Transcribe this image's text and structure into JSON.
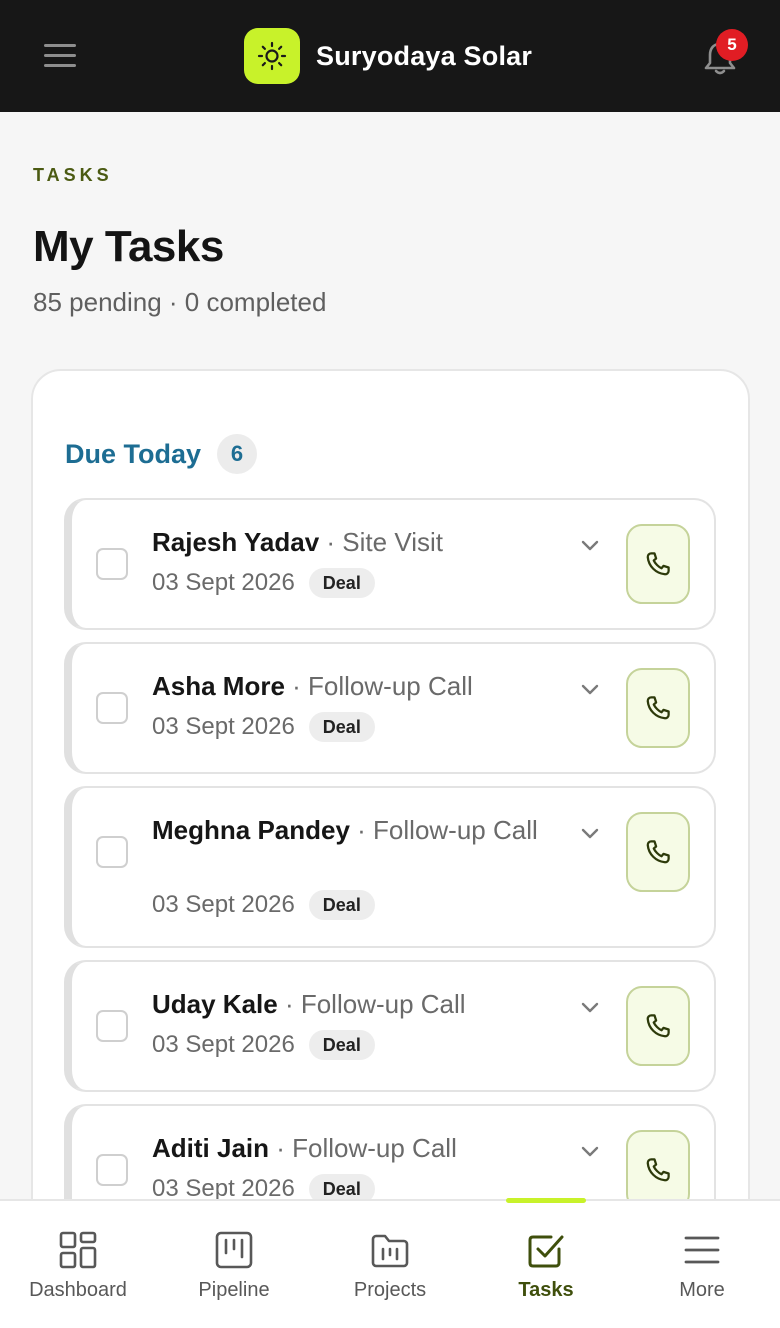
{
  "app": {
    "name": "Suryodaya Solar",
    "brand_color": "#c8f22a",
    "notification_count": "5"
  },
  "page": {
    "eyebrow": "TASKS",
    "title": "My Tasks",
    "subtitle": "85 pending · 0 completed"
  },
  "section": {
    "title": "Due Today",
    "count": "6"
  },
  "tasks": [
    {
      "name": "Rajesh Yadav",
      "type": " · Site Visit",
      "date": "03 Sept 2026",
      "tag": "Deal"
    },
    {
      "name": "Asha More",
      "type": " · Follow-up Call",
      "date": "03 Sept 2026",
      "tag": "Deal"
    },
    {
      "name": "Meghna Pandey",
      "type": " · Follow-up Call",
      "date": "03 Sept 2026",
      "tag": "Deal"
    },
    {
      "name": "Uday Kale",
      "type": " · Follow-up Call",
      "date": "03 Sept 2026",
      "tag": "Deal"
    },
    {
      "name": "Aditi Jain",
      "type": " · Follow-up Call",
      "date": "03 Sept 2026",
      "tag": "Deal"
    }
  ],
  "nav": {
    "items": [
      {
        "label": "Dashboard",
        "icon": "grid-icon"
      },
      {
        "label": "Pipeline",
        "icon": "kanban-icon"
      },
      {
        "label": "Projects",
        "icon": "folder-icon"
      },
      {
        "label": "Tasks",
        "icon": "checkbox-icon",
        "active": true
      },
      {
        "label": "More",
        "icon": "menu-icon"
      }
    ]
  }
}
